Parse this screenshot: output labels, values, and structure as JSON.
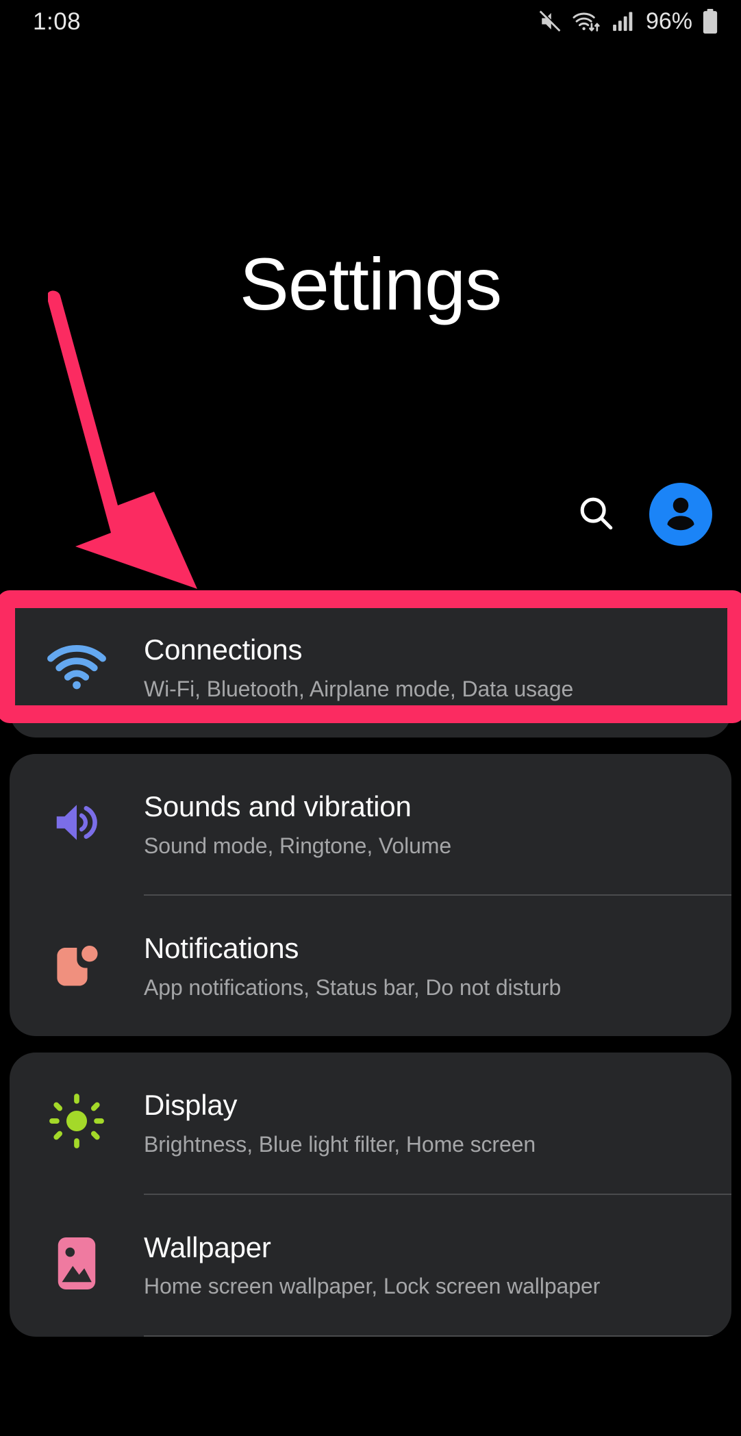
{
  "status_bar": {
    "clock": "1:08",
    "battery_percent": "96%",
    "icons": [
      "mute-icon",
      "wifi-transfer-icon",
      "cellular-signal-icon",
      "battery-icon"
    ]
  },
  "header": {
    "title": "Settings",
    "search_icon": "search-icon",
    "avatar_icon": "account-avatar-icon",
    "avatar_color": "#1b84f7"
  },
  "annotation": {
    "arrow_color": "#fb2b61",
    "highlight_color": "#fb2b61",
    "highlight_target": "Connections"
  },
  "settings": {
    "groups": [
      {
        "items": [
          {
            "title": "Connections",
            "subtitle": "Wi-Fi, Bluetooth, Airplane mode, Data usage",
            "icon": "wifi-icon",
            "icon_color": "#64a8f0"
          }
        ]
      },
      {
        "items": [
          {
            "title": "Sounds and vibration",
            "subtitle": "Sound mode, Ringtone, Volume",
            "icon": "volume-icon",
            "icon_color": "#7b6ee8"
          },
          {
            "title": "Notifications",
            "subtitle": "App notifications, Status bar, Do not disturb",
            "icon": "notification-badge-icon",
            "icon_color": "#f0907e"
          }
        ]
      },
      {
        "items": [
          {
            "title": "Display",
            "subtitle": "Brightness, Blue light filter, Home screen",
            "icon": "brightness-sun-icon",
            "icon_color": "#a4d929"
          },
          {
            "title": "Wallpaper",
            "subtitle": "Home screen wallpaper, Lock screen wallpaper",
            "icon": "wallpaper-image-icon",
            "icon_color": "#ef7aa0"
          }
        ]
      }
    ]
  }
}
